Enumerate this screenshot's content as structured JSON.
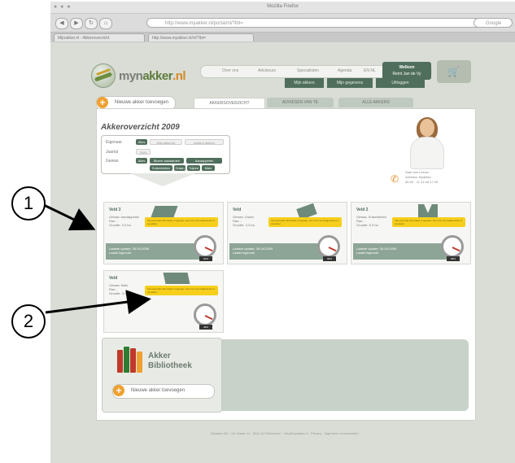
{
  "browser": {
    "window_title": "Mozilla Firefox",
    "url": "http://www.myakker.nl/portal/nl/?ibt=",
    "search_placeholder": "Google",
    "tabs": [
      "Mijnakker.nl - Akkeroverzicht",
      "http://www.myakker.nl/nl/?ibt="
    ],
    "nav_back": "◀",
    "nav_forward": "▶",
    "nav_reload": "↻",
    "nav_home": "⌂"
  },
  "site": {
    "logo_prefix": "myn",
    "logo_main": "akker",
    "logo_suffix": ".nl",
    "top_nav": [
      "Over ons",
      "Adviseurs",
      "Specialisten",
      "Agenda",
      "EN NL"
    ],
    "login": {
      "line1": "Welkom",
      "line2": "Reint Jan de Vy"
    },
    "green_nav": [
      "Mijn akkers",
      "Mijn gegevens",
      "Uitloggen"
    ],
    "cart_icon": "cart-icon"
  },
  "tabs": {
    "add_button": "Nieuwe akker toevoegen",
    "page_tabs": [
      "AKKERSOVERZICHT",
      "ADVIESEN VAN TE",
      "ALLE AKKERS"
    ]
  },
  "main": {
    "heading": "Akkeroverzicht 2009",
    "filters": {
      "eigenaar_label": "Eigenaar",
      "eigenaar_options": [
        "Alles",
        "Mijn akker(s)",
        "Andere akkers"
      ],
      "jaartal_label": "Jaartal",
      "jaartal_value": "2009",
      "gewas_label": "Gewas",
      "gewas_options": [
        "Alles",
        "Bloem zaaiaarden",
        "Aardappelen",
        "Suikerbieten",
        "Graan",
        "Tulpen",
        "Mais"
      ]
    },
    "contact": {
      "name": "Saar van Leeuw",
      "role": "Adviseur Myakker",
      "phone": "06-00 - 11 23 tot 17.00"
    }
  },
  "fields": [
    {
      "name": "Veld 3",
      "meta": [
        "Gewas: Aardappelen",
        "Ras: -",
        "Grootte: 3.3 ha"
      ],
      "notice": "Vul eerst alle informatie in (gewas, ras) voor uw zaaiperiode of uw akker.",
      "status": [
        "Laatste update: 26-04-2009",
        "Laatst ingevuld"
      ],
      "gauge_value": "63%"
    },
    {
      "name": "Veld",
      "meta": [
        "Gewas: Graan",
        "Ras: -",
        "Grootte: 4.3 ha"
      ],
      "notice": "Vul eerst alle informatie in (gewas, ras) voor uw zaaiperiode of uw akker.",
      "status": [
        "Laatste update: 26-04-2009",
        "Laatst ingevuld"
      ],
      "gauge_value": "68%"
    },
    {
      "name": "Veld 2",
      "meta": [
        "Gewas: Suikerbieten",
        "Ras: -",
        "Grootte: 5.3 ha"
      ],
      "notice": "Vul eerst alle informatie in (gewas, ras) voor uw zaaiperiode of uw akker.",
      "status": [
        "Laatste update: 26-04-2009",
        "Laatst ingevuld"
      ],
      "gauge_value": "68%"
    },
    {
      "name": "Veld",
      "meta": [
        "Gewas: Mais",
        "Ras: -",
        "Grootte: 3.3 ha"
      ],
      "notice": "Vul eerst alle informatie in (gewas, ras) voor uw zaaiperiode of uw akker.",
      "status": [
        "",
        ""
      ],
      "gauge_value": "48%"
    }
  ],
  "library": {
    "title1": "Akker",
    "title2": "Bibliotheek",
    "add_button": "Nieuwe akker toevoegen"
  },
  "footer": {
    "text": "Myakker BV · De Gaase 11 · 5611 AJ Eindhoven · info@myakker.nl · Privacy · Algemene voorwaarden"
  },
  "annotations": {
    "one": "1",
    "two": "2"
  },
  "colors": {
    "dark_green": "#4f6e5b",
    "accent_orange": "#f0a030",
    "notice_yellow": "#f6cf1c"
  }
}
